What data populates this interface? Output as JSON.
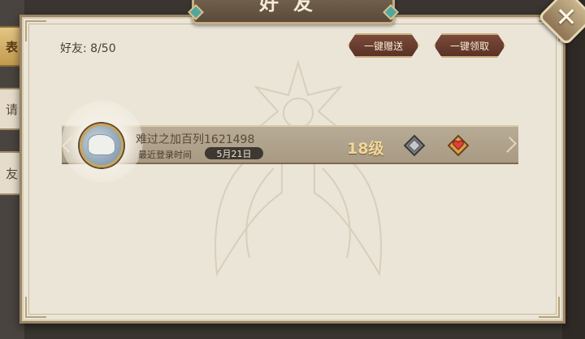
{
  "window": {
    "title": "好友"
  },
  "close_button": {
    "label": "✕"
  },
  "side_tabs": [
    {
      "label": "列表",
      "active": true
    },
    {
      "label": "申请",
      "active": false
    },
    {
      "label": "加好友",
      "active": false
    }
  ],
  "side_tab_visible": [
    "表",
    "请",
    "友"
  ],
  "friend_count": "好友: 8/50",
  "buttons": {
    "gift_all": "一键赠送",
    "claim_all": "一键领取"
  },
  "friends": [
    {
      "name": "难过之加百列1621498",
      "last_login_label": "最近登录时间",
      "last_login_date": "5月21日",
      "level": "18级",
      "gift_icon": "silver-gem-icon",
      "claim_icon": "heart-gift-icon"
    }
  ],
  "colors": {
    "panel": "#ebe5d8",
    "row": "#b0a28b",
    "button": "#6a3d30",
    "level": "#f2d79a"
  }
}
